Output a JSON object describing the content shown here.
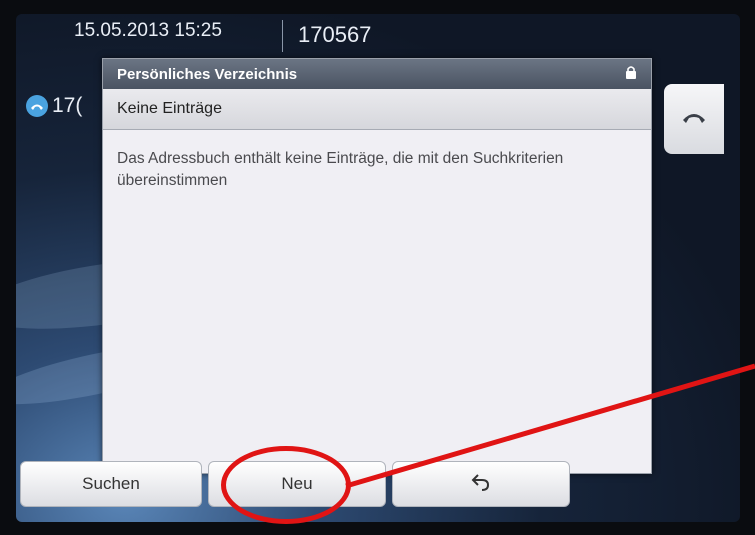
{
  "status_bar": {
    "datetime": "15.05.2013 15:25",
    "extension": "170567"
  },
  "line_key": {
    "label": "17(",
    "icon": "handset-icon"
  },
  "dialog": {
    "title": "Persönliches Verzeichnis",
    "lock_icon": "lock-icon",
    "subtitle": "Keine Einträge",
    "message": "Das Adressbuch enthält keine Einträge, die mit den Suchkriterien übereinstimmen"
  },
  "softkeys": {
    "search": "Suchen",
    "new": "Neu",
    "back_icon": "back-arrow-icon"
  },
  "annotation": {
    "color": "#e01414"
  }
}
